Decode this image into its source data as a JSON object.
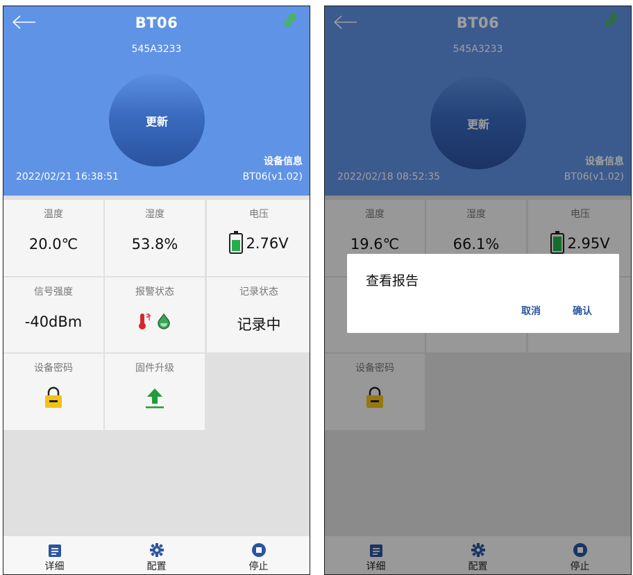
{
  "screens": [
    {
      "header": {
        "title": "BT06",
        "serial": "545A3233",
        "update_button": "更新",
        "device_info_link": "设备信息",
        "datetime": "2022/02/21 16:38:51",
        "firmware_version": "BT06(v1.02)"
      },
      "cells": {
        "temperature": {
          "label": "温度",
          "value": "20.0℃"
        },
        "humidity": {
          "label": "湿度",
          "value": "53.8%"
        },
        "voltage": {
          "label": "电压",
          "value": "2.76V",
          "battery_level": 0.75
        },
        "signal": {
          "label": "信号强度",
          "value": "-40dBm"
        },
        "alarm": {
          "label": "报警状态",
          "icons": [
            "thermometer-high-icon",
            "water-drop-icon"
          ]
        },
        "record": {
          "label": "记录状态",
          "value": "记录中"
        },
        "password": {
          "label": "设备密码",
          "icon": "lock-icon"
        },
        "firmware": {
          "label": "固件升级",
          "icon": "upload-icon"
        }
      },
      "nav": [
        {
          "label": "详细",
          "icon": "list-icon"
        },
        {
          "label": "配置",
          "icon": "gear-icon"
        },
        {
          "label": "停止",
          "icon": "stop-icon"
        }
      ]
    },
    {
      "header": {
        "title": "BT06",
        "serial": "545A3233",
        "update_button": "更新",
        "device_info_link": "设备信息",
        "datetime": "2022/02/18 08:52:35",
        "firmware_version": "BT06(v1.02)"
      },
      "cells": {
        "temperature": {
          "label": "温度",
          "value": "19.6℃"
        },
        "humidity": {
          "label": "湿度",
          "value": "66.1%"
        },
        "voltage": {
          "label": "电压",
          "value": "2.95V",
          "battery_level": 0.95
        },
        "password": {
          "label": "设备密码",
          "icon": "lock-icon"
        }
      },
      "dialog": {
        "title": "查看报告",
        "cancel": "取消",
        "confirm": "确认"
      },
      "nav": [
        {
          "label": "详细",
          "icon": "list-icon"
        },
        {
          "label": "配置",
          "icon": "gear-icon"
        },
        {
          "label": "停止",
          "icon": "stop-icon"
        }
      ]
    }
  ],
  "colors": {
    "header_blue": "#5f93e6",
    "battery_green": "#22b04a",
    "lock_yellow": "#f2c21b",
    "upload_green": "#1f9d3a",
    "nav_blue": "#2b55a0",
    "link_green": "#3fbf3f"
  }
}
